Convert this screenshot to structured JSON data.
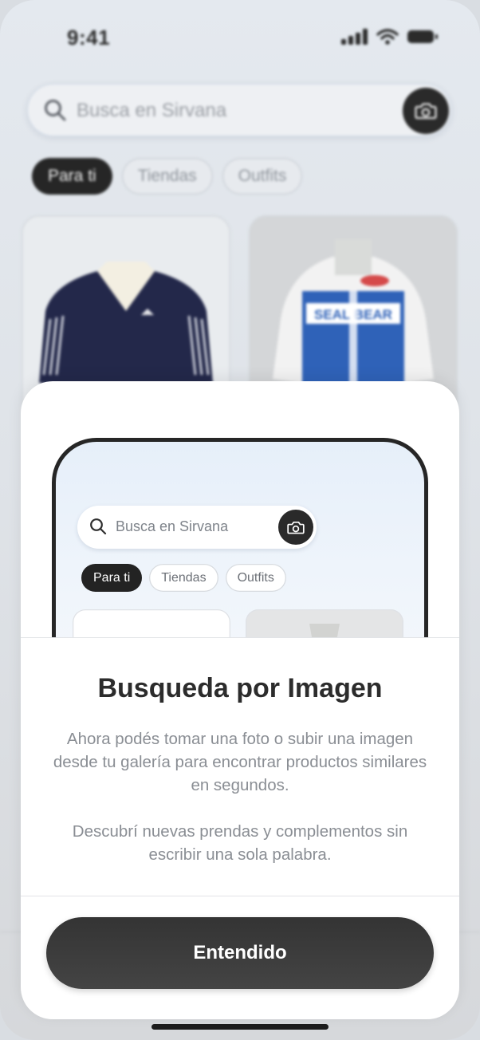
{
  "status_bar": {
    "time": "9:41"
  },
  "background_app": {
    "search": {
      "placeholder": "Busca en Sirvana"
    },
    "tabs": [
      {
        "label": "Para ti",
        "active": true
      },
      {
        "label": "Tiendas",
        "active": false
      },
      {
        "label": "Outfits",
        "active": false
      }
    ],
    "products": [
      {
        "image": "navy-track-jacket"
      },
      {
        "image": "blue-racing-jacket"
      }
    ]
  },
  "modal": {
    "preview": {
      "search": {
        "placeholder": "Busca en Sirvana"
      },
      "tabs": [
        {
          "label": "Para ti",
          "active": true
        },
        {
          "label": "Tiendas",
          "active": false
        },
        {
          "label": "Outfits",
          "active": false
        }
      ]
    },
    "title": "Busqueda por Imagen",
    "body": [
      "Ahora podés tomar una foto o subir una imagen desde tu galería para encontrar productos similares en segundos.",
      "Descubrí nuevas prendas y complementos sin escribir una sola palabra."
    ],
    "cta_label": "Entendido"
  },
  "colors": {
    "accent_dark": "#2a2a2a",
    "sheet_bg": "#ffffff",
    "text_muted": "#8a8e94"
  }
}
